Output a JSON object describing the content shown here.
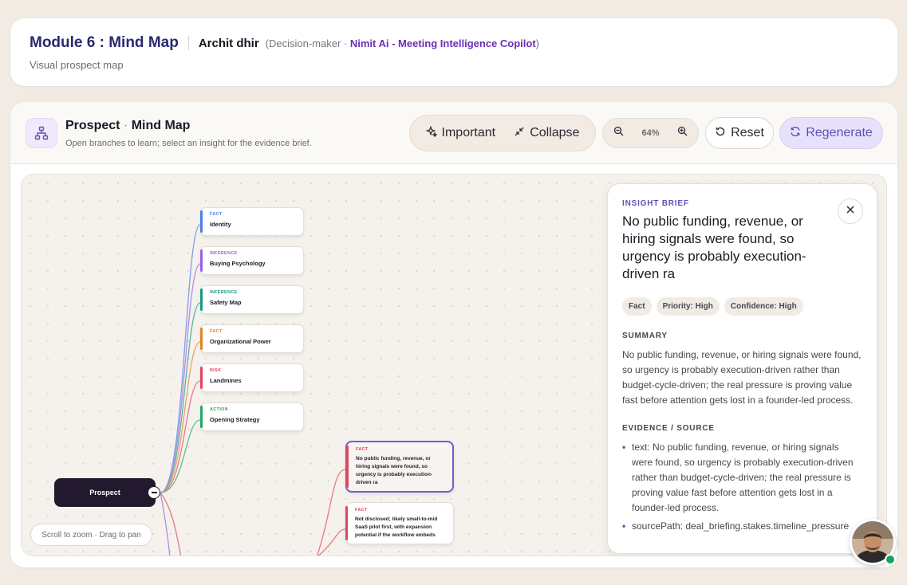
{
  "header": {
    "module_title": "Module 6 : Mind Map",
    "person_name": "Archit dhir",
    "role_prefix": "(Decision-maker · ",
    "company": "Nimit Ai - Meeting Intelligence Copilot",
    "role_suffix": ")",
    "subtitle": "Visual prospect map"
  },
  "toolbar": {
    "title_main": "Prospect",
    "title_sep": " · ",
    "title_rest": "Mind Map",
    "subtitle": "Open branches to learn; select an insight for the evidence brief.",
    "important_label": "Important",
    "collapse_label": "Collapse",
    "zoom_level": "64%",
    "reset_label": "Reset",
    "regenerate_label": "Regenerate"
  },
  "canvas": {
    "root_label": "Prospect",
    "hint": "Scroll to zoom · Drag to pan",
    "branches": [
      {
        "type": "FACT",
        "label": "Identity",
        "color": "#4d7fe3"
      },
      {
        "type": "INFERENCE",
        "label": "Buying Psychology",
        "color": "#9a5fe0"
      },
      {
        "type": "INFERENCE",
        "label": "Safety Map",
        "color": "#139a86"
      },
      {
        "type": "FACT",
        "label": "Organizational Power",
        "color": "#e0842a"
      },
      {
        "type": "RISK",
        "label": "Landmines",
        "color": "#e0475f"
      },
      {
        "type": "ACTION",
        "label": "Opening Strategy",
        "color": "#22a86a"
      }
    ],
    "insights": [
      {
        "type": "FACT",
        "text": "No public funding, revenue, or hiring signals were found, so urgency is probably execution-driven ra"
      },
      {
        "type": "FACT",
        "text": "Not disclosed; likely small-to-mid SaaS pilot first, with expansion potential if the workflow embeds"
      }
    ]
  },
  "brief": {
    "kicker": "INSIGHT BRIEF",
    "title": "No public funding, revenue, or hiring signals were found, so urgency is probably execution-driven ra",
    "chips": [
      "Fact",
      "Priority: High",
      "Confidence: High"
    ],
    "summary_heading": "SUMMARY",
    "summary": "No public funding, revenue, or hiring signals were found, so urgency is probably execution-driven rather than budget-cycle-driven; the real pressure is proving value fast before attention gets lost in a founder-led process.",
    "evidence_heading": "EVIDENCE / SOURCE",
    "evidence": [
      "text: No public funding, revenue, or hiring signals were found, so urgency is probably execution-driven rather than budget-cycle-driven; the real pressure is proving value fast before attention gets lost in a founder-led process.",
      "sourcePath: deal_briefing.stakes.timeline_pressure"
    ]
  }
}
